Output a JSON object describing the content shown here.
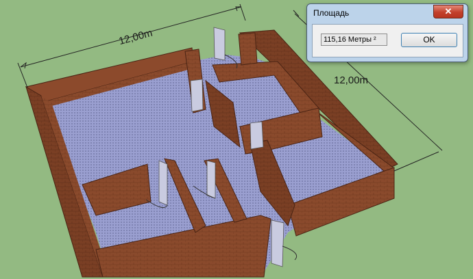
{
  "dimensions": {
    "top_length": "12,00m",
    "right_length": "12,00m"
  },
  "dialog": {
    "title": "Площадь",
    "close_symbol": "✕",
    "area_value": "115,16 Метры ²",
    "ok_label": "OK"
  },
  "colors": {
    "background": "#93ba82",
    "wall_brick": "#8c4a2a",
    "floor": "#9a9fcf",
    "door": "#c8cbe0"
  }
}
